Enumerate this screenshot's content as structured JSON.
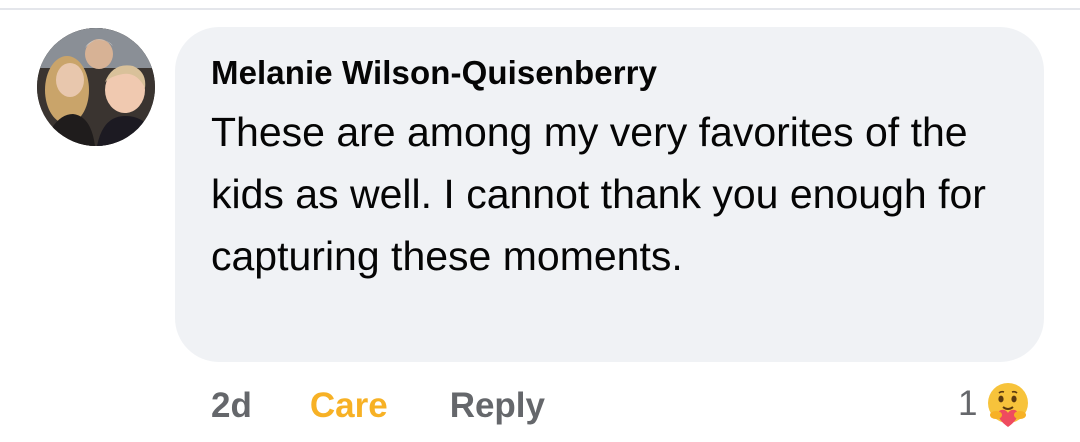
{
  "comment": {
    "author": "Melanie Wilson-Quisenberry",
    "text": "These are among my very favorites of the kids as well. I cannot thank you enough for capturing these moments.",
    "avatar_icon": "profile-photo",
    "bubble_color": "#f0f2f5"
  },
  "actions": {
    "timestamp": "2d",
    "reaction_label": "Care",
    "reaction_color": "#f7b125",
    "reply_label": "Reply"
  },
  "reactions": {
    "count": "1",
    "icon": "care-emoji-icon"
  }
}
